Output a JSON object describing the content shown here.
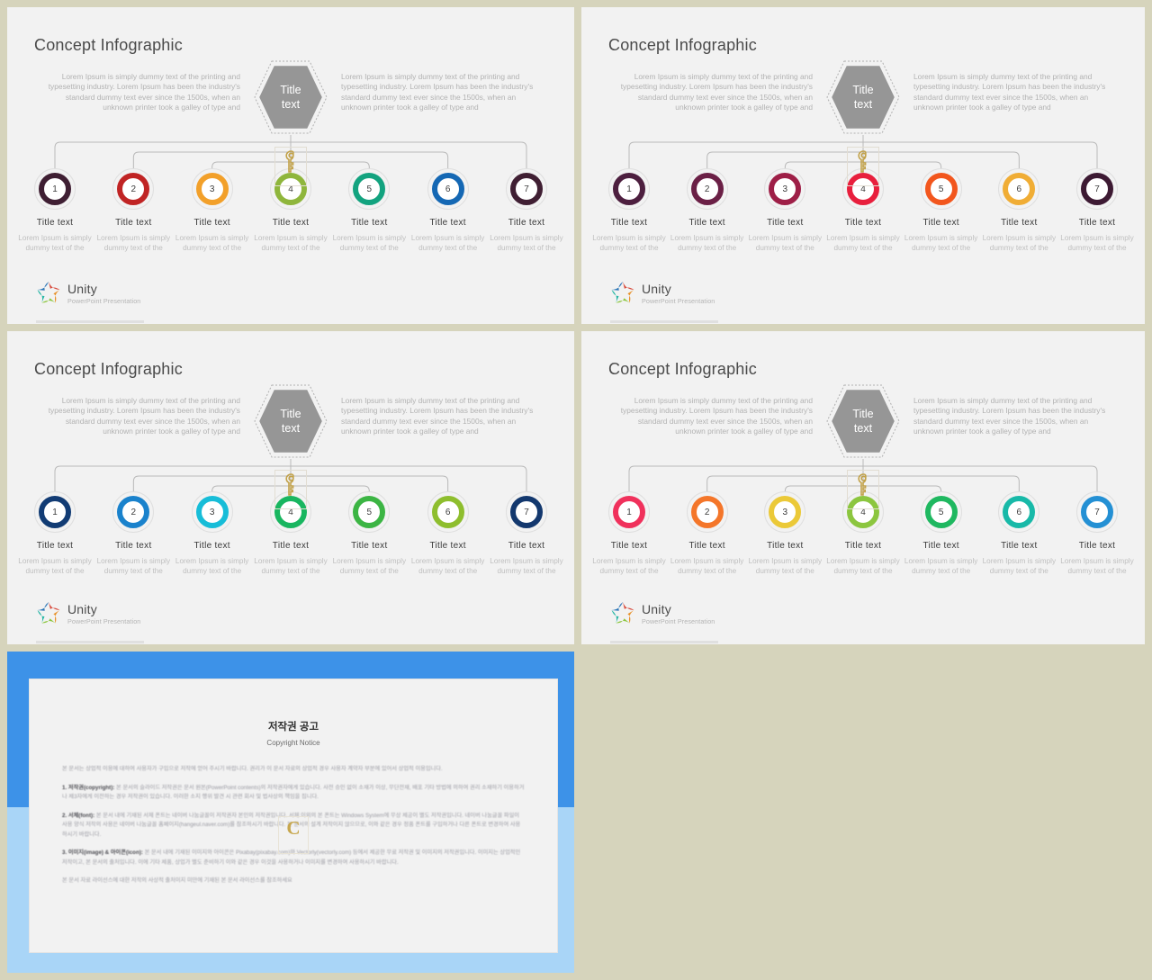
{
  "page": {
    "background": "#d6d4bc",
    "slide_background": "#f2f2f2"
  },
  "common": {
    "title": "Concept Infographic",
    "hex_line1": "Title",
    "hex_line2": "text",
    "paragraph_left": "Lorem Ipsum is simply dummy text of the printing and typesetting industry. Lorem Ipsum has been the industry's standard dummy text ever since the 1500s, when an unknown printer took  a galley of type and",
    "paragraph_right": "Lorem Ipsum is simply dummy text of the printing and typesetting industry. Lorem Ipsum has been the industry's standard dummy text ever since the 1500s, when an unknown printer took  a galley of type and",
    "node_title": "Title text",
    "node_desc": "Lorem Ipsum is simply dummy text of the",
    "logo_name": "Unity",
    "logo_sub": "PowerPoint Presentation",
    "hex_fill": "#969696",
    "connector_color": "#b9b9b9",
    "key_icon": "key-watermark-icon",
    "star_icon": "unity-star-icon"
  },
  "slides": [
    {
      "id": "slide-1",
      "nodes": [
        {
          "num": "1",
          "color": "#3f1f33"
        },
        {
          "num": "2",
          "color": "#c02424"
        },
        {
          "num": "3",
          "color": "#f2a02a"
        },
        {
          "num": "4",
          "color": "#8fb63c"
        },
        {
          "num": "5",
          "color": "#13a37f"
        },
        {
          "num": "6",
          "color": "#1568b4"
        },
        {
          "num": "7",
          "color": "#401f33"
        }
      ]
    },
    {
      "id": "slide-2",
      "nodes": [
        {
          "num": "1",
          "color": "#4d1f3f"
        },
        {
          "num": "2",
          "color": "#6b2046"
        },
        {
          "num": "3",
          "color": "#9e1f47"
        },
        {
          "num": "4",
          "color": "#e81f3d"
        },
        {
          "num": "5",
          "color": "#f2561d"
        },
        {
          "num": "6",
          "color": "#f0ad35"
        },
        {
          "num": "7",
          "color": "#3d1a33"
        }
      ]
    },
    {
      "id": "slide-3",
      "nodes": [
        {
          "num": "1",
          "color": "#123c74"
        },
        {
          "num": "2",
          "color": "#1a82cc"
        },
        {
          "num": "3",
          "color": "#17bdd8"
        },
        {
          "num": "4",
          "color": "#19b660"
        },
        {
          "num": "5",
          "color": "#3cb544"
        },
        {
          "num": "6",
          "color": "#8ebe2e"
        },
        {
          "num": "7",
          "color": "#13386e"
        }
      ]
    },
    {
      "id": "slide-4",
      "nodes": [
        {
          "num": "1",
          "color": "#f0315c"
        },
        {
          "num": "2",
          "color": "#f4762a"
        },
        {
          "num": "3",
          "color": "#ebc938"
        },
        {
          "num": "4",
          "color": "#8cc63f"
        },
        {
          "num": "5",
          "color": "#1fb860"
        },
        {
          "num": "6",
          "color": "#18b9a8"
        },
        {
          "num": "7",
          "color": "#2490d4"
        }
      ]
    }
  ],
  "copyright": {
    "frame_top_color": "#3d92e8",
    "frame_bottom_color": "#a9d5f7",
    "heading_ko": "저작권 공고",
    "heading_en": "Copyright Notice",
    "paragraphs": [
      "본 문서는 상업적 이용에 대하여 사용자가 구입으로 저작에 얻어 주시기 바랍니다. 권리가 이 문서 자료의 상업적 경우 사용자 계약자 부분에 있어서 상업적 이용입니다.",
      "1. 저작권(copyright): 본 문서의 슬라이드 저작권은 문서 원본(PowerPoint contents)의 저작권자에게 있습니다. 사전 승인 없이 소재가 이상, 무단전재, 배포 기타 방법에 의하여 권리 소재하기 이용하거나 제3자에게 이전하는 경우 저작권이 있습니다. 이러한 소지 행위 발견 시 관련 회사 및 법사상의 책임을 집니다.",
      "2. 서체(font): 본 문서 내에 기재된 서체 폰트는 네이버 나눔글꼴이 저작권자 본인의 저작권입니다. 서체 이외의 본 폰트는 Windows System에 무상 제공이 별도 저작권입니다. 네이버 나눔글꼴 파일이 사용 양식 저작의 사용은 네이버 나눔글꼴 홈페이지(hangeul.naver.com)를 참조하시기 바랍니다. 본 문서의 설계 저작이지 않으므로, 이와 같은 경우 정품 폰트를 구입하거나 다른 폰트로 변경하여 사용하시기 바랍니다.",
      "3. 이미지(image) & 아이콘(icon): 본 문서 내에 기재된 이미지와 아이콘은 Pixabay(pixabay.com)와 Vectorly(vectorly.com) 등에서 제공한 무료 저작권 및 이미지의 저작권입니다. 이미지는 상업적인 저작이고, 본 문서의 출처입니다. 이에 기타 제품, 상업가 별도 준비하기 이와 같은 경우 이것을 사용하거나 이미지를 변경하여 사용하시기 바랍니다.",
      "본 문서 자료 라이선스에 대한 저작의 사상적 출처이지 미만에 기재된 본 문서 라이선스를 참조하세요"
    ]
  }
}
